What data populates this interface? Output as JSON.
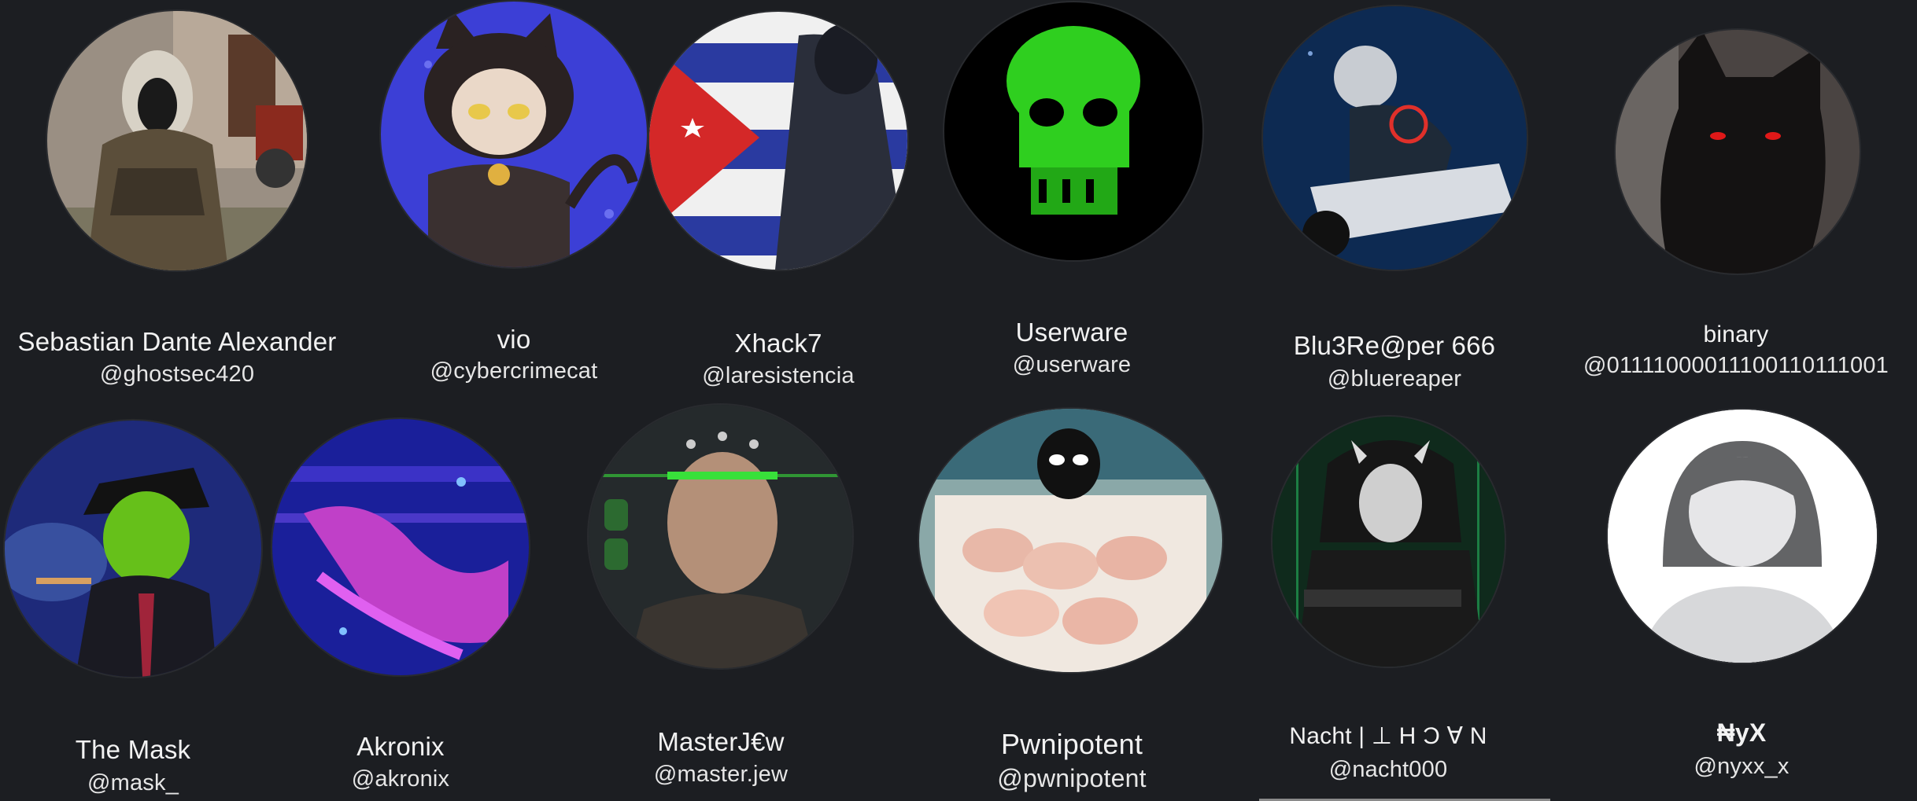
{
  "profiles": [
    {
      "name": "Sebastian Dante Alexander",
      "handle": "@ghostsec420",
      "avatar_icon": "soldier-photo-avatar"
    },
    {
      "name": "vio",
      "handle": "@cybercrimecat",
      "avatar_icon": "anime-catgirl-avatar"
    },
    {
      "name": "Xhack7",
      "handle": "@laresistencia",
      "avatar_icon": "cuban-flag-hacker-avatar"
    },
    {
      "name": "Userware",
      "handle": "@userware",
      "avatar_icon": "green-code-skull-avatar"
    },
    {
      "name": "Blu3Re@per 666",
      "handle": "@bluereaper",
      "avatar_icon": "biker-biohazard-avatar"
    },
    {
      "name": "binary",
      "handle": "@01111000011100110111001",
      "avatar_icon": "black-cat-red-eyes-avatar"
    },
    {
      "name": "The Mask",
      "handle": "@mask_",
      "avatar_icon": "green-mask-man-avatar"
    },
    {
      "name": "Akronix",
      "handle": "@akronix",
      "avatar_icon": "blue-purple-glitch-avatar"
    },
    {
      "name": "MasterJ€w",
      "handle": "@master.jew",
      "avatar_icon": "electrode-head-man-avatar"
    },
    {
      "name": "Pwnipotent",
      "handle": "@pwnipotent",
      "avatar_icon": "masked-man-chickens-avatar"
    },
    {
      "name": "Nacht | ⊥ H Ɔ ∀ N",
      "handle": "@nacht000",
      "avatar_icon": "oni-mask-soldier-avatar"
    },
    {
      "name": "₦yX",
      "handle": "@nyxx_x",
      "avatar_icon": "default-person-avatar"
    }
  ]
}
